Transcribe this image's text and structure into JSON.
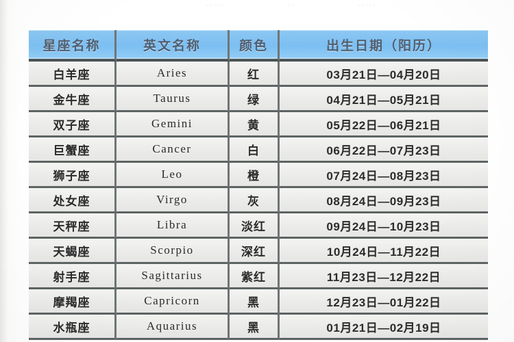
{
  "page": {
    "top_remnant_marks": [
      "·····",
      "··",
      "·····"
    ]
  },
  "table": {
    "columns": [
      {
        "key": "name",
        "label": "星座名称"
      },
      {
        "key": "en",
        "label": "英文名称"
      },
      {
        "key": "color",
        "label": "颜色"
      },
      {
        "key": "date",
        "label": "出生日期（阳历）"
      }
    ],
    "rows": [
      {
        "name": "白羊座",
        "en": "Aries",
        "color": "红",
        "date": "03月21日—04月20日"
      },
      {
        "name": "金牛座",
        "en": "Taurus",
        "color": "绿",
        "date": "04月21日—05月21日"
      },
      {
        "name": "双子座",
        "en": "Gemini",
        "color": "黄",
        "date": "05月22日—06月21日"
      },
      {
        "name": "巨蟹座",
        "en": "Cancer",
        "color": "白",
        "date": "06月22日—07月23日"
      },
      {
        "name": "狮子座",
        "en": "Leo",
        "color": "橙",
        "date": "07月24日—08月23日"
      },
      {
        "name": "处女座",
        "en": "Virgo",
        "color": "灰",
        "date": "08月24日—09月23日"
      },
      {
        "name": "天秤座",
        "en": "Libra",
        "color": "淡红",
        "date": "09月24日—10月23日"
      },
      {
        "name": "天蝎座",
        "en": "Scorpio",
        "color": "深红",
        "date": "10月24日—11月22日"
      },
      {
        "name": "射手座",
        "en": "Sagittarius",
        "color": "紫红",
        "date": "11月23日—12月22日"
      },
      {
        "name": "摩羯座",
        "en": "Capricorn",
        "color": "黑",
        "date": "12月23日—01月22日"
      },
      {
        "name": "水瓶座",
        "en": "Aquarius",
        "color": "黑",
        "date": "01月21日—02月19日"
      }
    ]
  },
  "colors": {
    "header_blue": "#7cbff2",
    "header_text": "#4f5f71",
    "cell_bg": "#ececeb",
    "grid_line": "#5d6463",
    "body_text": "#2b2b2b",
    "page_bg": "#ffffff"
  }
}
